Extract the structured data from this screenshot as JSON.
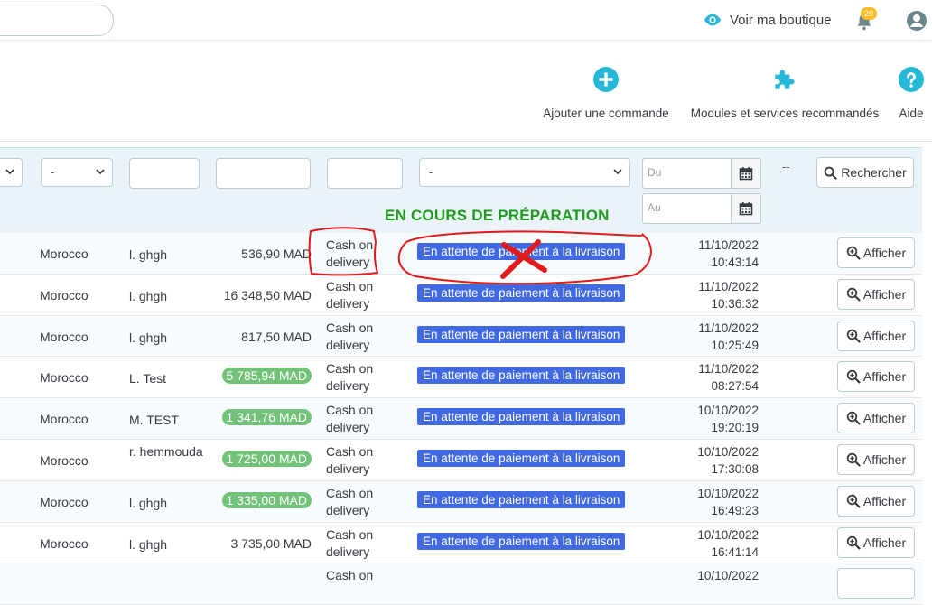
{
  "header": {
    "view_shop": "Voir ma boutique",
    "notifications": "20"
  },
  "toolbar": {
    "add_order": "Ajouter une commande",
    "modules": "Modules et services recommandés",
    "help": "Aide"
  },
  "filters": {
    "select_dash": "-",
    "status_select": "-",
    "date_from": "Du",
    "date_to": "Au",
    "range_separator": "--",
    "search_button": "Rechercher"
  },
  "annotation": {
    "label": "EN COURS DE PRÉPARATION"
  },
  "colors": {
    "status_blue": "#4169e1",
    "total_badge_green": "#72c279",
    "annotation_green": "#1e9b1e",
    "annotation_red": "#e01b1b",
    "icon_teal": "#25b9d7"
  },
  "orders": [
    {
      "country": "Morocco",
      "customer": "l. ghgh",
      "total": "536,90 MAD",
      "badge": false,
      "payment": "Cash on delivery",
      "status": "En attente de paiement à la livraison",
      "date": "11/10/2022",
      "time": "10:43:14",
      "action": "Afficher"
    },
    {
      "country": "Morocco",
      "customer": "l. ghgh",
      "total": "16 348,50 MAD",
      "badge": false,
      "payment": "Cash on delivery",
      "status": "En attente de paiement à la livraison",
      "date": "11/10/2022",
      "time": "10:36:32",
      "action": "Afficher"
    },
    {
      "country": "Morocco",
      "customer": "l. ghgh",
      "total": "817,50 MAD",
      "badge": false,
      "payment": "Cash on delivery",
      "status": "En attente de paiement à la livraison",
      "date": "11/10/2022",
      "time": "10:25:49",
      "action": "Afficher"
    },
    {
      "country": "Morocco",
      "customer": "L. Test",
      "total": "5 785,94 MAD",
      "badge": true,
      "payment": "Cash on delivery",
      "status": "En attente de paiement à la livraison",
      "date": "11/10/2022",
      "time": "08:27:54",
      "action": "Afficher"
    },
    {
      "country": "Morocco",
      "customer": "M. TEST",
      "total": "1 341,76 MAD",
      "badge": true,
      "payment": "Cash on delivery",
      "status": "En attente de paiement à la livraison",
      "date": "10/10/2022",
      "time": "19:20:19",
      "action": "Afficher"
    },
    {
      "country": "Morocco",
      "customer": "r. hemmouda",
      "total": "1 725,00 MAD",
      "badge": true,
      "payment": "Cash on delivery",
      "status": "En attente de paiement à la livraison",
      "date": "10/10/2022",
      "time": "17:30:08",
      "action": "Afficher"
    },
    {
      "country": "Morocco",
      "customer": "l. ghgh",
      "total": "1 335,00 MAD",
      "badge": true,
      "payment": "Cash on delivery",
      "status": "En attente de paiement à la livraison",
      "date": "10/10/2022",
      "time": "16:49:23",
      "action": "Afficher"
    },
    {
      "country": "Morocco",
      "customer": "l. ghgh",
      "total": "3 735,00 MAD",
      "badge": false,
      "payment": "Cash on delivery",
      "status": "En attente de paiement à la livraison",
      "date": "10/10/2022",
      "time": "16:41:14",
      "action": "Afficher"
    },
    {
      "country": "",
      "customer": "",
      "total": "",
      "badge": false,
      "payment": "Cash on",
      "status": "",
      "date": "10/10/2022",
      "time": "",
      "action": ""
    }
  ]
}
